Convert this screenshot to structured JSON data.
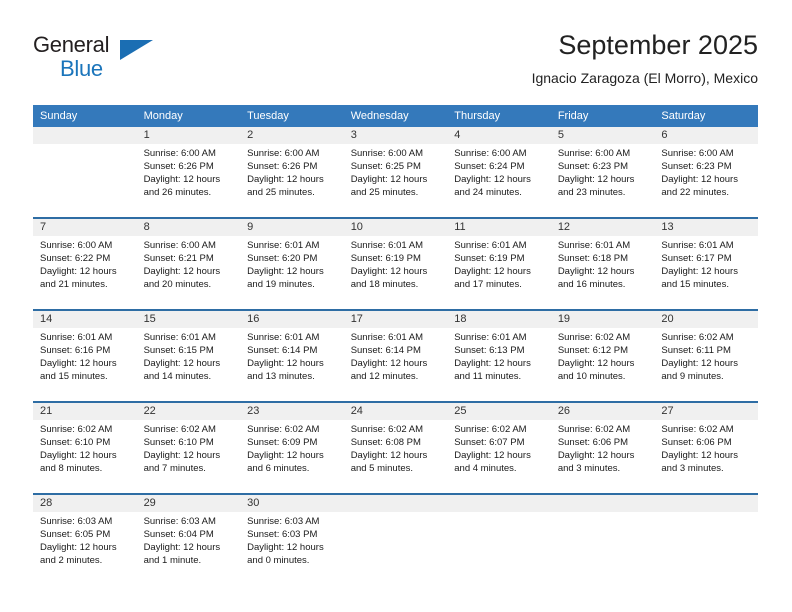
{
  "brand": {
    "name_part1": "General",
    "name_part2": "Blue",
    "accent_color": "#1b75bb",
    "triangle_color": "#1b6eb3"
  },
  "header": {
    "title": "September 2025",
    "subtitle": "Ignacio Zaragoza (El Morro), Mexico",
    "header_bg": "#3479bb",
    "row_divider_color": "#2e6da4",
    "daynum_band_bg": "#f0f0f0"
  },
  "weekday_headers": [
    "Sunday",
    "Monday",
    "Tuesday",
    "Wednesday",
    "Thursday",
    "Friday",
    "Saturday"
  ],
  "weeks": [
    [
      {
        "day": "",
        "sunrise": "",
        "sunset": "",
        "daylight1": "",
        "daylight2": "",
        "empty": true
      },
      {
        "day": "1",
        "sunrise": "Sunrise: 6:00 AM",
        "sunset": "Sunset: 6:26 PM",
        "daylight1": "Daylight: 12 hours",
        "daylight2": "and 26 minutes.",
        "empty": false
      },
      {
        "day": "2",
        "sunrise": "Sunrise: 6:00 AM",
        "sunset": "Sunset: 6:26 PM",
        "daylight1": "Daylight: 12 hours",
        "daylight2": "and 25 minutes.",
        "empty": false
      },
      {
        "day": "3",
        "sunrise": "Sunrise: 6:00 AM",
        "sunset": "Sunset: 6:25 PM",
        "daylight1": "Daylight: 12 hours",
        "daylight2": "and 25 minutes.",
        "empty": false
      },
      {
        "day": "4",
        "sunrise": "Sunrise: 6:00 AM",
        "sunset": "Sunset: 6:24 PM",
        "daylight1": "Daylight: 12 hours",
        "daylight2": "and 24 minutes.",
        "empty": false
      },
      {
        "day": "5",
        "sunrise": "Sunrise: 6:00 AM",
        "sunset": "Sunset: 6:23 PM",
        "daylight1": "Daylight: 12 hours",
        "daylight2": "and 23 minutes.",
        "empty": false
      },
      {
        "day": "6",
        "sunrise": "Sunrise: 6:00 AM",
        "sunset": "Sunset: 6:23 PM",
        "daylight1": "Daylight: 12 hours",
        "daylight2": "and 22 minutes.",
        "empty": false
      }
    ],
    [
      {
        "day": "7",
        "sunrise": "Sunrise: 6:00 AM",
        "sunset": "Sunset: 6:22 PM",
        "daylight1": "Daylight: 12 hours",
        "daylight2": "and 21 minutes.",
        "empty": false
      },
      {
        "day": "8",
        "sunrise": "Sunrise: 6:00 AM",
        "sunset": "Sunset: 6:21 PM",
        "daylight1": "Daylight: 12 hours",
        "daylight2": "and 20 minutes.",
        "empty": false
      },
      {
        "day": "9",
        "sunrise": "Sunrise: 6:01 AM",
        "sunset": "Sunset: 6:20 PM",
        "daylight1": "Daylight: 12 hours",
        "daylight2": "and 19 minutes.",
        "empty": false
      },
      {
        "day": "10",
        "sunrise": "Sunrise: 6:01 AM",
        "sunset": "Sunset: 6:19 PM",
        "daylight1": "Daylight: 12 hours",
        "daylight2": "and 18 minutes.",
        "empty": false
      },
      {
        "day": "11",
        "sunrise": "Sunrise: 6:01 AM",
        "sunset": "Sunset: 6:19 PM",
        "daylight1": "Daylight: 12 hours",
        "daylight2": "and 17 minutes.",
        "empty": false
      },
      {
        "day": "12",
        "sunrise": "Sunrise: 6:01 AM",
        "sunset": "Sunset: 6:18 PM",
        "daylight1": "Daylight: 12 hours",
        "daylight2": "and 16 minutes.",
        "empty": false
      },
      {
        "day": "13",
        "sunrise": "Sunrise: 6:01 AM",
        "sunset": "Sunset: 6:17 PM",
        "daylight1": "Daylight: 12 hours",
        "daylight2": "and 15 minutes.",
        "empty": false
      }
    ],
    [
      {
        "day": "14",
        "sunrise": "Sunrise: 6:01 AM",
        "sunset": "Sunset: 6:16 PM",
        "daylight1": "Daylight: 12 hours",
        "daylight2": "and 15 minutes.",
        "empty": false
      },
      {
        "day": "15",
        "sunrise": "Sunrise: 6:01 AM",
        "sunset": "Sunset: 6:15 PM",
        "daylight1": "Daylight: 12 hours",
        "daylight2": "and 14 minutes.",
        "empty": false
      },
      {
        "day": "16",
        "sunrise": "Sunrise: 6:01 AM",
        "sunset": "Sunset: 6:14 PM",
        "daylight1": "Daylight: 12 hours",
        "daylight2": "and 13 minutes.",
        "empty": false
      },
      {
        "day": "17",
        "sunrise": "Sunrise: 6:01 AM",
        "sunset": "Sunset: 6:14 PM",
        "daylight1": "Daylight: 12 hours",
        "daylight2": "and 12 minutes.",
        "empty": false
      },
      {
        "day": "18",
        "sunrise": "Sunrise: 6:01 AM",
        "sunset": "Sunset: 6:13 PM",
        "daylight1": "Daylight: 12 hours",
        "daylight2": "and 11 minutes.",
        "empty": false
      },
      {
        "day": "19",
        "sunrise": "Sunrise: 6:02 AM",
        "sunset": "Sunset: 6:12 PM",
        "daylight1": "Daylight: 12 hours",
        "daylight2": "and 10 minutes.",
        "empty": false
      },
      {
        "day": "20",
        "sunrise": "Sunrise: 6:02 AM",
        "sunset": "Sunset: 6:11 PM",
        "daylight1": "Daylight: 12 hours",
        "daylight2": "and 9 minutes.",
        "empty": false
      }
    ],
    [
      {
        "day": "21",
        "sunrise": "Sunrise: 6:02 AM",
        "sunset": "Sunset: 6:10 PM",
        "daylight1": "Daylight: 12 hours",
        "daylight2": "and 8 minutes.",
        "empty": false
      },
      {
        "day": "22",
        "sunrise": "Sunrise: 6:02 AM",
        "sunset": "Sunset: 6:10 PM",
        "daylight1": "Daylight: 12 hours",
        "daylight2": "and 7 minutes.",
        "empty": false
      },
      {
        "day": "23",
        "sunrise": "Sunrise: 6:02 AM",
        "sunset": "Sunset: 6:09 PM",
        "daylight1": "Daylight: 12 hours",
        "daylight2": "and 6 minutes.",
        "empty": false
      },
      {
        "day": "24",
        "sunrise": "Sunrise: 6:02 AM",
        "sunset": "Sunset: 6:08 PM",
        "daylight1": "Daylight: 12 hours",
        "daylight2": "and 5 minutes.",
        "empty": false
      },
      {
        "day": "25",
        "sunrise": "Sunrise: 6:02 AM",
        "sunset": "Sunset: 6:07 PM",
        "daylight1": "Daylight: 12 hours",
        "daylight2": "and 4 minutes.",
        "empty": false
      },
      {
        "day": "26",
        "sunrise": "Sunrise: 6:02 AM",
        "sunset": "Sunset: 6:06 PM",
        "daylight1": "Daylight: 12 hours",
        "daylight2": "and 3 minutes.",
        "empty": false
      },
      {
        "day": "27",
        "sunrise": "Sunrise: 6:02 AM",
        "sunset": "Sunset: 6:06 PM",
        "daylight1": "Daylight: 12 hours",
        "daylight2": "and 3 minutes.",
        "empty": false
      }
    ],
    [
      {
        "day": "28",
        "sunrise": "Sunrise: 6:03 AM",
        "sunset": "Sunset: 6:05 PM",
        "daylight1": "Daylight: 12 hours",
        "daylight2": "and 2 minutes.",
        "empty": false
      },
      {
        "day": "29",
        "sunrise": "Sunrise: 6:03 AM",
        "sunset": "Sunset: 6:04 PM",
        "daylight1": "Daylight: 12 hours",
        "daylight2": "and 1 minute.",
        "empty": false
      },
      {
        "day": "30",
        "sunrise": "Sunrise: 6:03 AM",
        "sunset": "Sunset: 6:03 PM",
        "daylight1": "Daylight: 12 hours",
        "daylight2": "and 0 minutes.",
        "empty": false
      },
      {
        "day": "",
        "sunrise": "",
        "sunset": "",
        "daylight1": "",
        "daylight2": "",
        "empty": true
      },
      {
        "day": "",
        "sunrise": "",
        "sunset": "",
        "daylight1": "",
        "daylight2": "",
        "empty": true
      },
      {
        "day": "",
        "sunrise": "",
        "sunset": "",
        "daylight1": "",
        "daylight2": "",
        "empty": true
      },
      {
        "day": "",
        "sunrise": "",
        "sunset": "",
        "daylight1": "",
        "daylight2": "",
        "empty": true
      }
    ]
  ]
}
